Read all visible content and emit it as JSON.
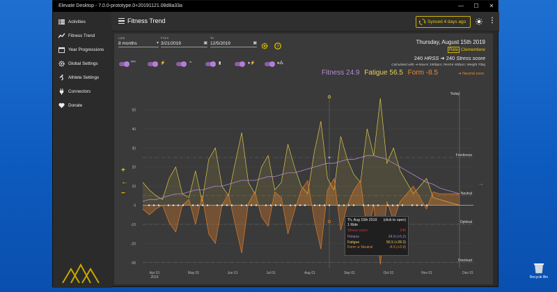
{
  "window": {
    "title": "Elevate Desktop - 7.0.0-prototype.0+20191121.08d8a33a",
    "minimize": "—",
    "maximize": "☐",
    "close": "✕"
  },
  "sidebar": {
    "items": [
      {
        "label": "Activities",
        "icon": "list-icon"
      },
      {
        "label": "Fitness Trend",
        "icon": "trend-icon"
      },
      {
        "label": "Year Progressions",
        "icon": "calendar-icon"
      },
      {
        "label": "Global Settings",
        "icon": "gear-icon"
      },
      {
        "label": "Athlete Settings",
        "icon": "athlete-icon"
      },
      {
        "label": "Connectors",
        "icon": "plug-icon"
      },
      {
        "label": "Donate",
        "icon": "heart-icon"
      }
    ]
  },
  "header": {
    "title": "Fitness Trend",
    "sync_label": "Synced 4 days ago"
  },
  "filters": {
    "last_label": "Last",
    "last_value": "8 months",
    "from_label": "From",
    "from_value": "3/21/2019",
    "to_label": "To",
    "to_value": "12/5/2019"
  },
  "details": {
    "date": "Thursday, August 15th 2019",
    "activity_type": "Ride",
    "activity_name": "Clementiere",
    "hrss": "240",
    "hrss_unit": "HRSS",
    "arrow": "➔",
    "stress": "240",
    "stress_unit": "Stress score",
    "calc": "Calculated with ➔ MaxHr 190bpm; RestHr 60bpm; Weight 70kg"
  },
  "legend": {
    "fitness": "Fitness 24.9",
    "fatigue": "Fatigue 56.5",
    "form": "Form -8.5",
    "neutral_zone": "➔ Neutral zone"
  },
  "toggles": [
    {
      "icon": "heart-rate-icon",
      "glyph": "ᵐᵐ"
    },
    {
      "icon": "bolt-icon",
      "glyph": "⚡"
    },
    {
      "icon": "swim-icon",
      "glyph": "≈"
    },
    {
      "icon": "battery-icon",
      "glyph": "▮"
    },
    {
      "icon": "pin-bolt-icon",
      "glyph": "♦⚡"
    },
    {
      "icon": "pin-ski-icon",
      "glyph": "♦⁂"
    }
  ],
  "colors": {
    "fitness": "#b48ad6",
    "fatigue": "#e0c84a",
    "form": "#e07f2a",
    "accent": "#e8c800"
  },
  "chart_data": {
    "type": "line",
    "y_ticks": [
      "50",
      "40",
      "30",
      "20",
      "10",
      "0",
      "-10",
      "-20",
      "-30"
    ],
    "ylim": [
      -33,
      60
    ],
    "x_ticks": [
      "Apr 01",
      "Jun 01",
      "Jul 01",
      "Aug 01",
      "Sep 01",
      "Oct 01",
      "Nov 01",
      "Dec 01"
    ],
    "x_extra": [
      "May 01"
    ],
    "x_year": "2019",
    "zones": [
      {
        "name": "Today",
        "value": null
      },
      {
        "name": "Freshness",
        "value": 25
      },
      {
        "name": "Neutral",
        "value": 5
      },
      {
        "name": "Optimal",
        "value": -10
      },
      {
        "name": "Overload",
        "value": -30
      }
    ],
    "series": [
      {
        "name": "Fatigue",
        "values": [
          12,
          8,
          5,
          3,
          14,
          20,
          6,
          4,
          18,
          2,
          24,
          30,
          10,
          5,
          22,
          38,
          12,
          6,
          20,
          26,
          8,
          12,
          32,
          20,
          10,
          6,
          28,
          44,
          14,
          8,
          36,
          24,
          16,
          12,
          40,
          26,
          56,
          22,
          30,
          18,
          12,
          6,
          10,
          14,
          4,
          3,
          2,
          1,
          0
        ]
      },
      {
        "name": "Fitness",
        "values": [
          2,
          3,
          3,
          4,
          5,
          6,
          6,
          7,
          8,
          8,
          9,
          10,
          10,
          11,
          12,
          13,
          13,
          13,
          14,
          15,
          15,
          16,
          17,
          17,
          18,
          19,
          20,
          21,
          22,
          22,
          23,
          24,
          24,
          25,
          26,
          26,
          25,
          24,
          22,
          20,
          18,
          16,
          14,
          12,
          11,
          9,
          8,
          7,
          6
        ]
      },
      {
        "name": "Form",
        "values": [
          -2,
          -5,
          -2,
          0,
          -9,
          -14,
          0,
          3,
          -10,
          5,
          -15,
          -20,
          0,
          6,
          -10,
          -25,
          1,
          7,
          -6,
          -11,
          7,
          4,
          -15,
          -3,
          8,
          13,
          -8,
          -23,
          8,
          14,
          -13,
          0,
          8,
          13,
          -14,
          0,
          -31,
          2,
          -8,
          2,
          6,
          10,
          4,
          -2,
          7,
          6,
          6,
          6,
          6
        ]
      }
    ]
  },
  "tooltip": {
    "title": "Th, Aug 15th 2019",
    "hint": "(click to open)",
    "rides": "1 Ride",
    "stress_label": "Stress score",
    "stress_value": "240",
    "fitness_label": "Fitness",
    "fitness_value": "24.9 (+5.2)",
    "fatigue_label": "Fatigue",
    "fatigue_value": "56.5 (+28.3)",
    "form_label": "Form ➔ Neutral",
    "form_value": "-8.5 (+3.9)"
  },
  "desktop": {
    "recycle_label": "Recycle Bin"
  }
}
